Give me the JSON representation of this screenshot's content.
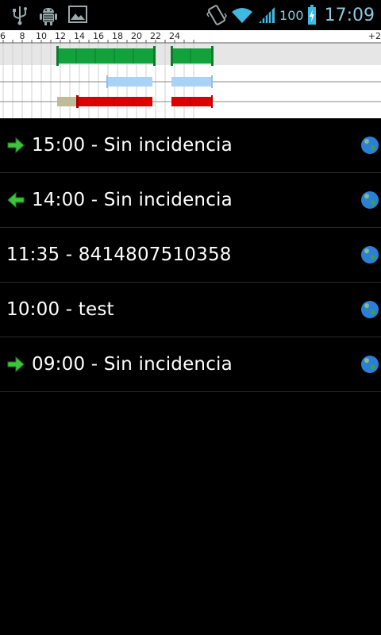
{
  "status_bar": {
    "battery": "100",
    "time": "17:09",
    "icons": [
      "usb-icon",
      "android-debug-icon",
      "image-icon",
      "vibrate-icon",
      "wifi-icon",
      "signal-icon",
      "battery-charging-icon"
    ]
  },
  "timeline": {
    "hour_labels": [
      "6",
      "8",
      "10",
      "12",
      "14",
      "16",
      "18",
      "20",
      "22",
      "24",
      "+2"
    ],
    "colors": {
      "green": "#12a23c",
      "light_blue": "#a9d3f5",
      "red": "#dd0000",
      "olive": "#bdbb98",
      "grid": "#cccccc"
    }
  },
  "entries": [
    {
      "text": "15:00 - Sin incidencia",
      "arrow": "right"
    },
    {
      "text": "14:00 - Sin incidencia",
      "arrow": "left"
    },
    {
      "text": "11:35 - 8414807510358",
      "arrow": ""
    },
    {
      "text": "10:00 - test",
      "arrow": ""
    },
    {
      "text": "09:00 - Sin incidencia",
      "arrow": "right"
    }
  ]
}
